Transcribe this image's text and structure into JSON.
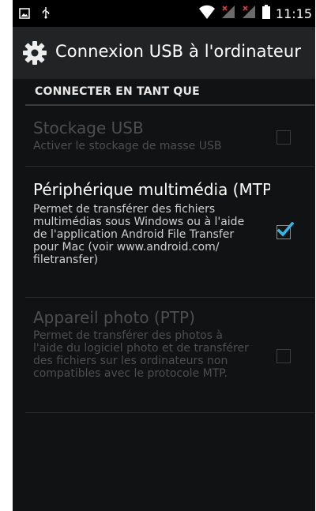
{
  "statusbar": {
    "time": "11:15"
  },
  "header": {
    "title": "Connexion USB à l'ordinateur"
  },
  "section": {
    "header": "CONNECTER EN TANT QUE"
  },
  "options": [
    {
      "title": "Stockage USB",
      "summary": "Activer le stockage de masse USB",
      "checked": false,
      "enabled": false
    },
    {
      "title": "Périphérique multimédia (MTP)",
      "summary": "Permet de transférer des fichiers multimédias sous Windows ou à l'aide de l'application Android File Transfer pour Mac (voir www.android.com/ filetransfer)",
      "checked": true,
      "enabled": true
    },
    {
      "title": "Appareil photo (PTP)",
      "summary": "Permet de transférer des photos à l'aide du logiciel photo et de transférer des fichiers sur les ordinateurs non compatibles avec le protocole MTP.",
      "checked": false,
      "enabled": false
    }
  ],
  "colors": {
    "accent": "#33b5e5",
    "background": "#111213",
    "actionbar": "#222325"
  },
  "icons": {
    "status_left": [
      "image-notification-icon",
      "usb-icon"
    ],
    "status_right": [
      "wifi-icon",
      "signal-icon",
      "signal-icon",
      "battery-icon"
    ],
    "header": "settings-gear-icon"
  }
}
